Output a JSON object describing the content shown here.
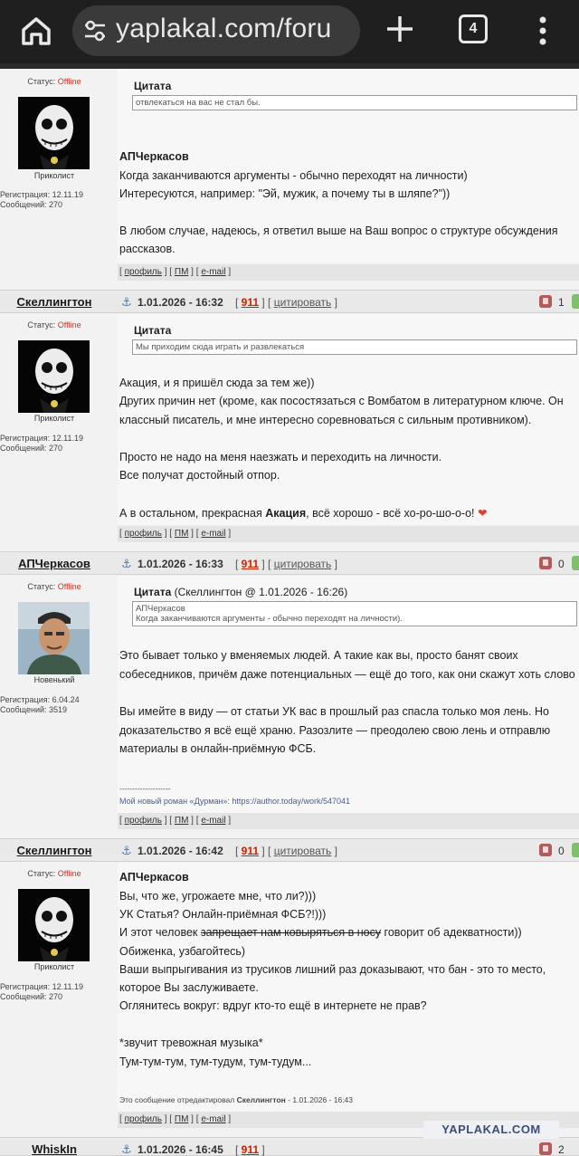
{
  "browser": {
    "url": "yaplakal.com/foru",
    "tab_count": "4"
  },
  "post0": {
    "status_label": "Статус:",
    "status_value": "Offline",
    "rank": "Приколист",
    "reg": "Регистрация: 12.11.19",
    "msgs": "Сообщений: 270",
    "quote_label": "Цитата",
    "quote_text": "отвлекаться на вас не стал бы.",
    "author": "АПЧеркасов",
    "lines": [
      "Когда заканчиваются аргументы - обычно переходят на личности)",
      "Интересуются, например: \"Эй, мужик, а почему ты в шляпе?\"))",
      "В любом случае, надеюсь, я ответил выше на Ваш вопрос о структуре обсуждения",
      "рассказов."
    ]
  },
  "footer": {
    "profile": "профиль",
    "pm": "ПМ",
    "email": "e-mail"
  },
  "post1": {
    "nick": "Скеллингтон",
    "date": "1.01.2026 - 16:32",
    "rep": "911",
    "cite": "цитировать",
    "votes": "1",
    "status_label": "Статус:",
    "status_value": "Offline",
    "rank": "Приколист",
    "reg": "Регистрация: 12.11.19",
    "msgs": "Сообщений: 270",
    "quote_label": "Цитата",
    "quote_text": "Мы приходим сюда играть и развлекаться",
    "lines": [
      "Акация, и я пришёл сюда за тем же))",
      "Других причин нет (кроме, как посостязаться с Вомбатом в литературном ключе. Он",
      "классный писатель, и мне интересно соревноваться с сильным противником).",
      "Просто не надо на меня наезжать и переходить на личности.",
      "Все получат достойный отпор."
    ],
    "last_a": "А в остальном, прекрасная ",
    "last_b": "Акация",
    "last_c": ", всё хорошо - всё хо-ро-шо-о-о! ",
    "heart": "❤"
  },
  "post2": {
    "nick": "АПЧеркасов",
    "date": "1.01.2026 - 16:33",
    "rep": "911",
    "cite": "цитировать",
    "votes": "0",
    "status_label": "Статус:",
    "status_value": "Offline",
    "rank": "Новенький",
    "reg": "Регистрация: 6.04.24",
    "msgs": "Сообщений: 3519",
    "quote_label": "Цитата",
    "quote_src": " (Скеллингтон @ 1.01.2026 - 16:26)",
    "quote_line1": "АПЧеркасов",
    "quote_line2": "Когда заканчиваются аргументы - обычно переходят на личности).",
    "lines": [
      "Это бывает только у вменяемых людей. А такие как вы, просто банят своих",
      "собеседников, причём даже потенциальных — ещё до того, как они скажут хоть слово",
      "Вы имейте в виду — от статьи УК вас в прошлый раз спасла только моя лень. Но",
      "доказательство я всё ещё храню. Разозлите — преодолею свою лень и отправлю",
      "материалы в онлайн-приёмную ФСБ."
    ],
    "sig_div": "--------------------",
    "sig": "Мой новый роман «Дурман»: https://author.today/work/547041"
  },
  "post3": {
    "nick": "Скеллингтон",
    "date": "1.01.2026 - 16:42",
    "rep": "911",
    "cite": "цитировать",
    "votes": "0",
    "status_label": "Статус:",
    "status_value": "Offline",
    "rank": "Приколист",
    "reg": "Регистрация: 12.11.19",
    "msgs": "Сообщений: 270",
    "author": "АПЧеркасов",
    "lines": [
      "Вы, что же, угрожаете мне, что ли?)))",
      "УК Статья? Онлайн-приёмная ФСБ?!)))"
    ],
    "line_a": "И этот человек ",
    "line_strike": "запрещает нам ковыряться в носу",
    "line_c": " говорит об адекватности))",
    "lines2": [
      "Обиженка, узбагойтесь)",
      "Ваши выпрыгивания из трусиков лишний раз доказывают, что бан - это то место,",
      "которое Вы заслуживаете.",
      "Оглянитесь вокруг: вдруг кто-то ещё в интернете не прав?",
      "*звучит тревожная музыка*",
      "Тум-тум-тум, тум-тудум, тум-тудум..."
    ],
    "edited_a": "Это сообщение отредактировал ",
    "edited_b": "Скеллингтон",
    "edited_c": " - 1.01.2026 - 16:43"
  },
  "post4": {
    "nick": "WhiskIn",
    "date": "1.01.2026 - 16:45",
    "rep": "911",
    "votes": "2"
  },
  "watermark": "YAPLAKAL.COM"
}
